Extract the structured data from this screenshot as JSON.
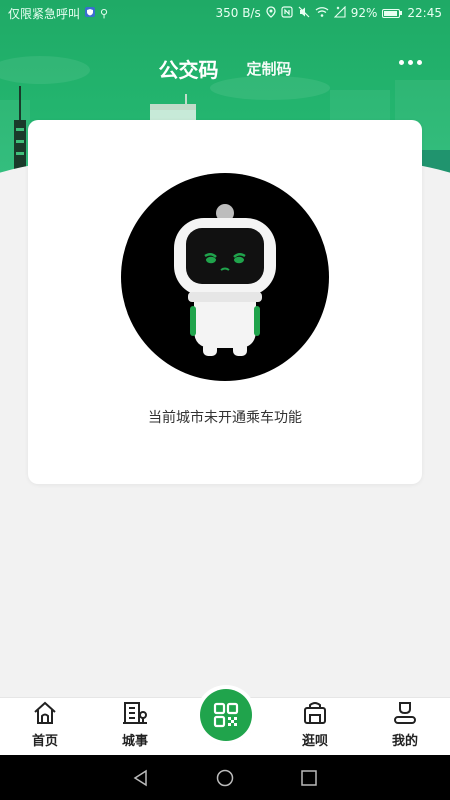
{
  "status_bar": {
    "carrier_text": "仅限紧急呼叫",
    "network_speed": "350 B/s",
    "battery_percent": "92%",
    "time": "22:45",
    "battery_level": 0.92
  },
  "header": {
    "active_tab": "公交码",
    "other_tab": "定制码"
  },
  "card": {
    "message": "当前城市未开通乘车功能"
  },
  "bottom_nav": {
    "items": [
      {
        "label": "首页",
        "icon": "home-icon"
      },
      {
        "label": "城事",
        "icon": "city-building-icon"
      },
      {
        "label": "",
        "icon": "qr-code-icon"
      },
      {
        "label": "逛呗",
        "icon": "shop-bag-icon"
      },
      {
        "label": "我的",
        "icon": "profile-icon"
      }
    ]
  },
  "colors": {
    "primary_green": "#20a44c",
    "header_green": "#23b46e"
  }
}
